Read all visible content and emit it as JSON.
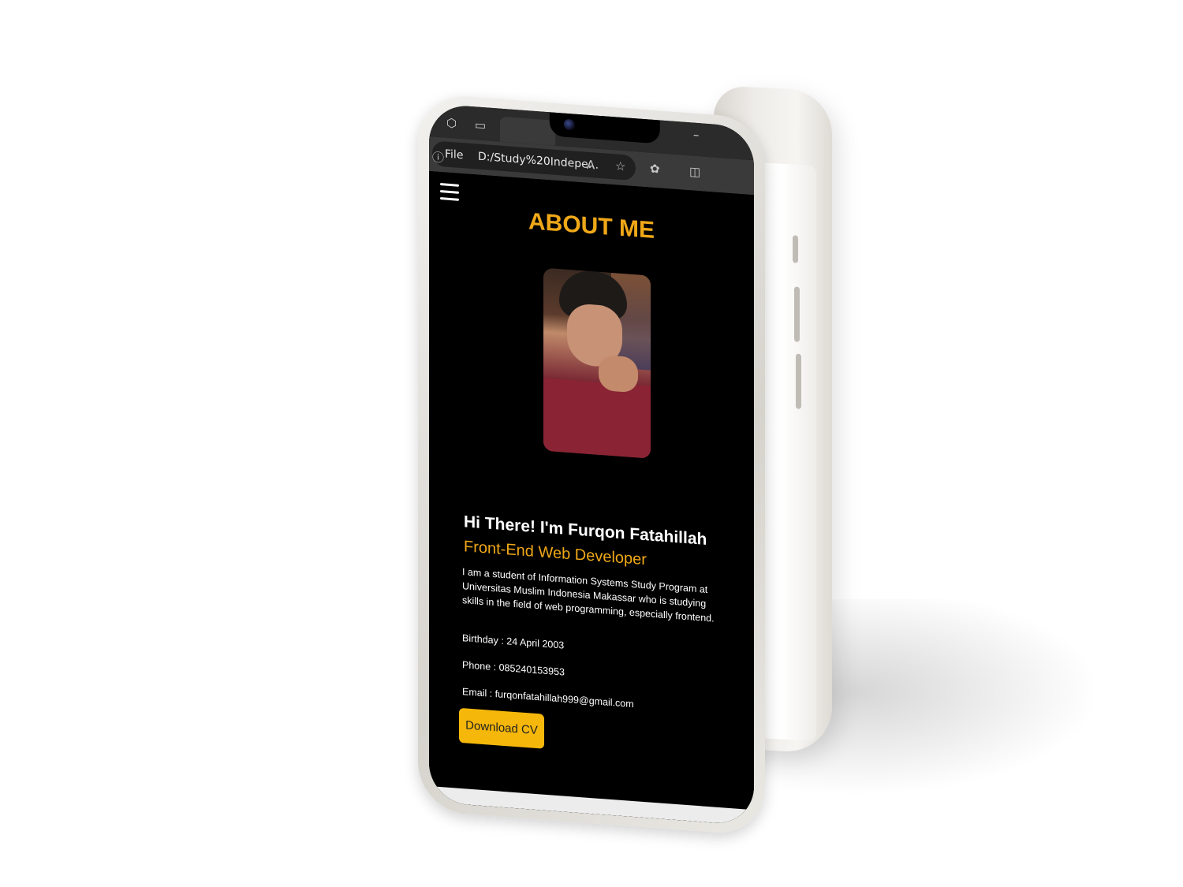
{
  "browser": {
    "address": {
      "scheme_label": "File",
      "url": "D:/Study%20Indepe..."
    }
  },
  "about": {
    "section_title": "ABOUT ME",
    "greeting": "Hi There! I'm Furqon Fatahillah",
    "role": "Front-End Web Developer",
    "bio": "I am a student of Information Systems Study Program at Universitas Muslim Indonesia Makassar who is studying skills in the field of web programming, especially frontend.",
    "birthday": "Birthday : 24 April 2003",
    "phone": "Phone : 085240153953",
    "email": "Email : furqonfatahillah999@gmail.com",
    "download_button": "Download CV"
  },
  "colors": {
    "accent": "#f0a818",
    "button": "#f5b70a",
    "background": "#000000"
  }
}
